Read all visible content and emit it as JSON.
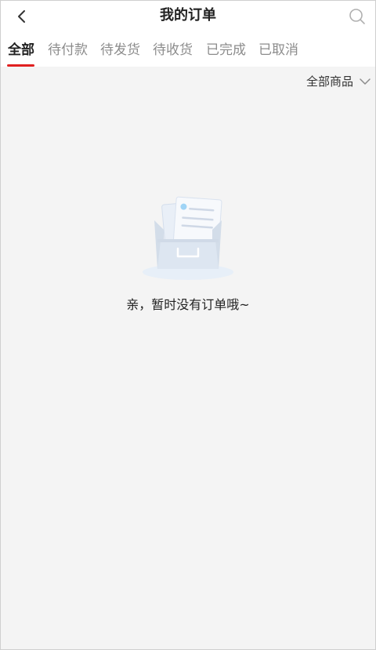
{
  "header": {
    "title": "我的订单",
    "back_icon": "chevron-left-icon",
    "search_icon": "search-icon"
  },
  "tabs": [
    {
      "label": "全部",
      "active": true
    },
    {
      "label": "待付款",
      "active": false
    },
    {
      "label": "待发货",
      "active": false
    },
    {
      "label": "待收货",
      "active": false
    },
    {
      "label": "已完成",
      "active": false
    },
    {
      "label": "已取消",
      "active": false
    }
  ],
  "filter": {
    "label": "全部商品",
    "icon": "chevron-down-icon"
  },
  "empty_state": {
    "icon": "empty-box-icon",
    "message": "亲，暂时没有订单哦~"
  },
  "colors": {
    "accent": "#e02020",
    "background": "#f4f4f4",
    "inactive_tab": "#8c8c8c"
  }
}
